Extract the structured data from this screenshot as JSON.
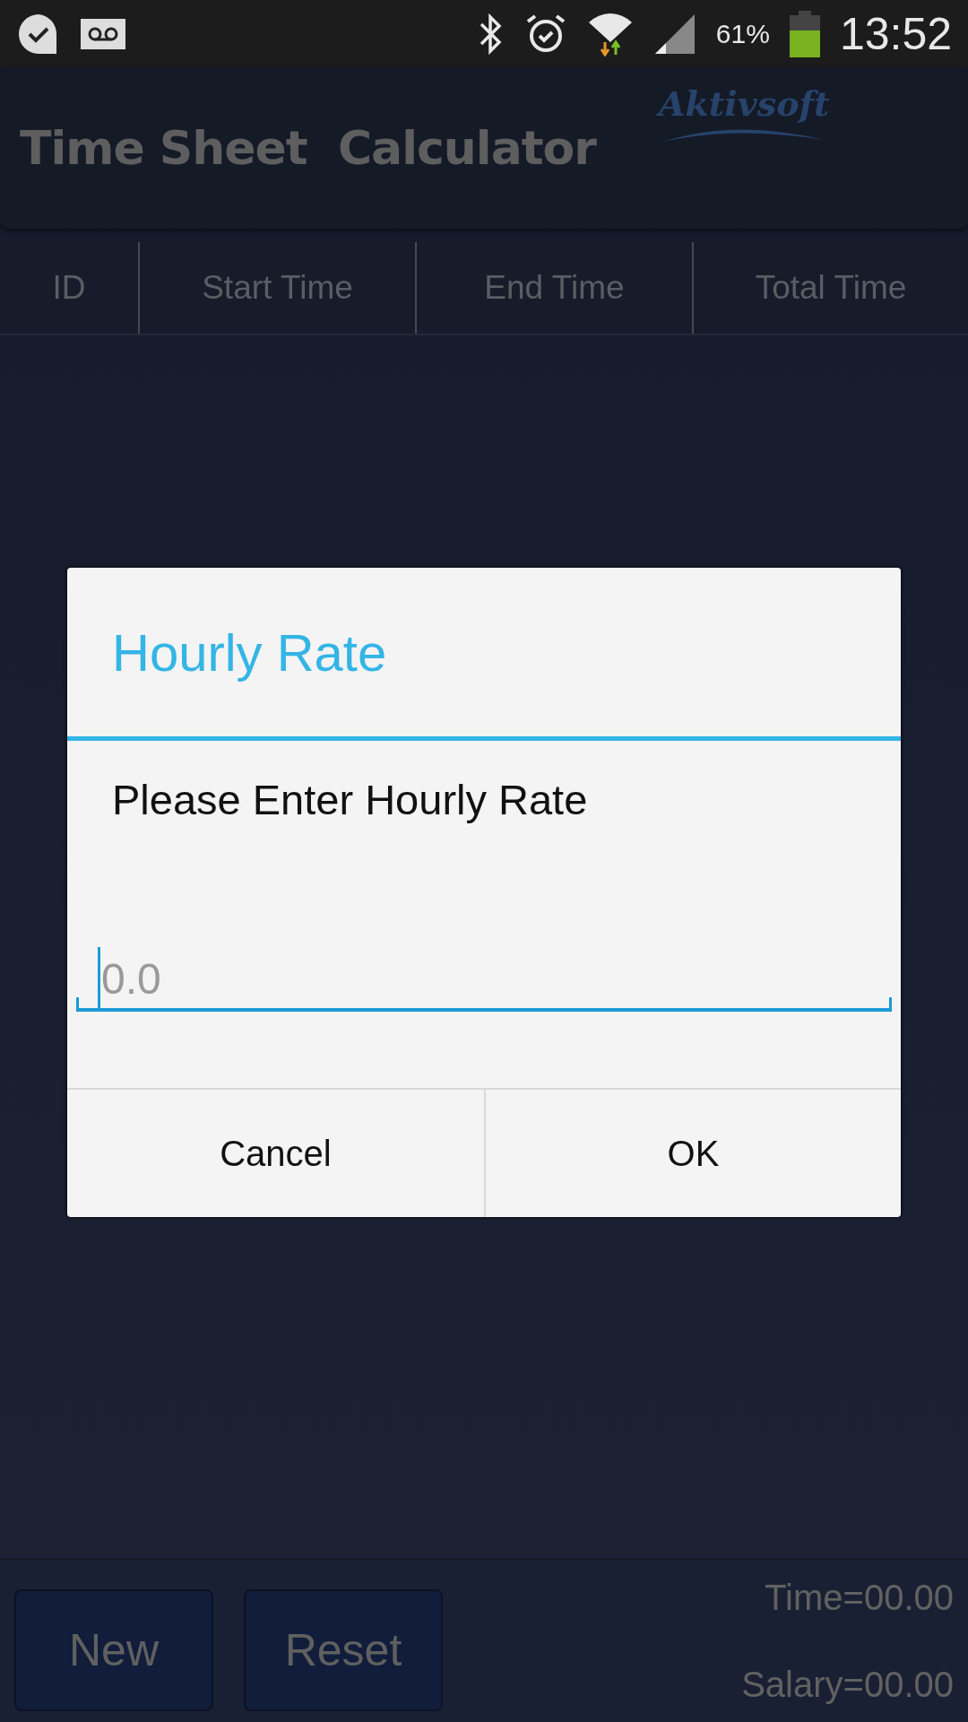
{
  "status_bar": {
    "battery": "61%",
    "time": "13:52"
  },
  "app": {
    "title": "Time Sheet  Calculator",
    "logo": "Aktivsoft"
  },
  "table": {
    "columns": [
      "ID",
      "Start Time",
      "End Time",
      "Total Time"
    ]
  },
  "footer": {
    "buttons": [
      "New",
      "Reset"
    ],
    "time": "Time=00.00",
    "salary": "Salary=00.00"
  },
  "dialog": {
    "title": "Hourly Rate",
    "message": "Please Enter Hourly Rate",
    "input": {
      "placeholder": "0.0"
    },
    "buttons": [
      "Cancel",
      "OK"
    ]
  }
}
